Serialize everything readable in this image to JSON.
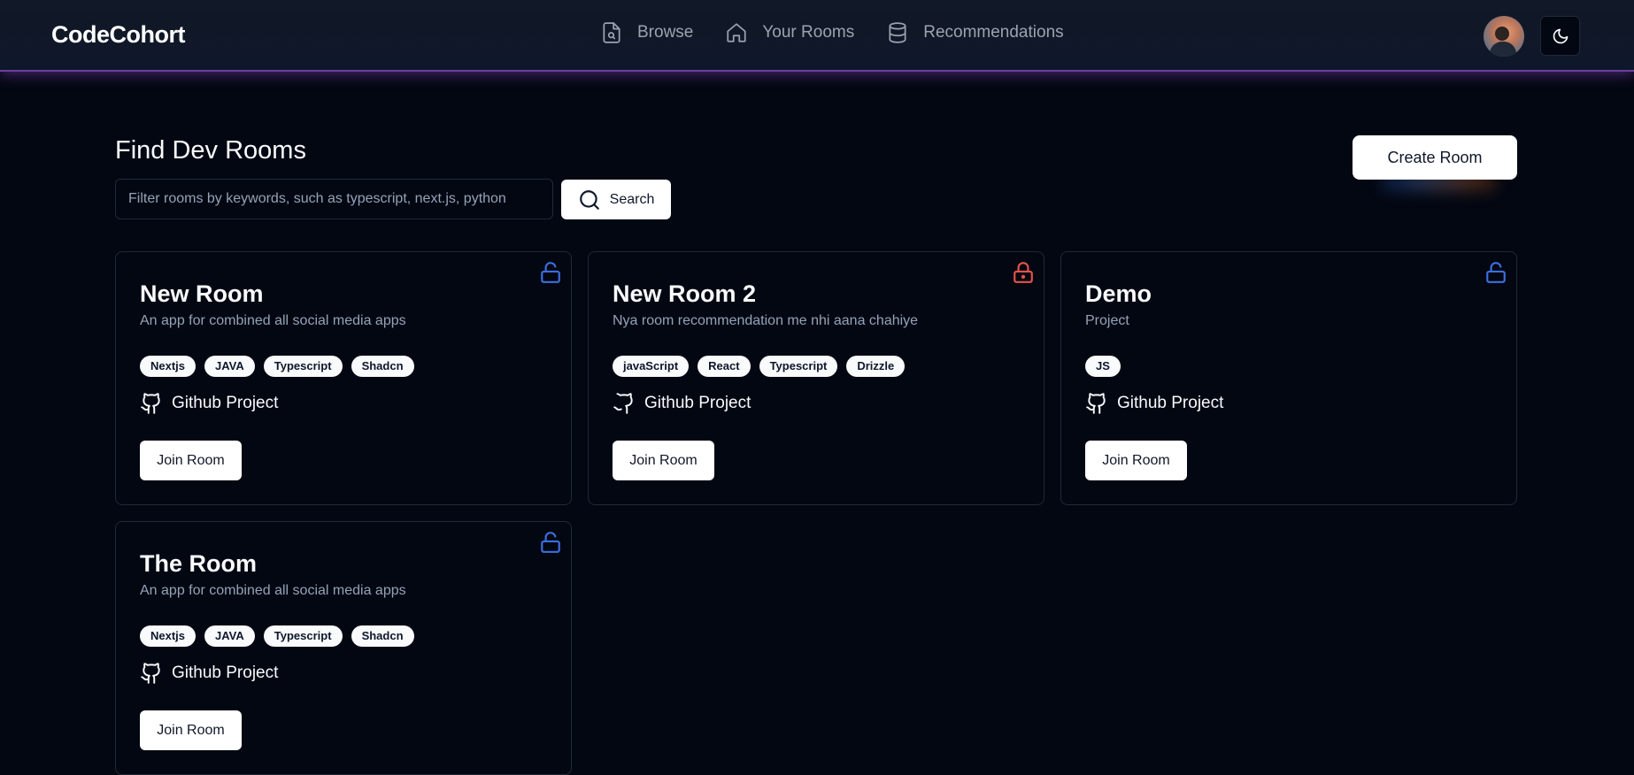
{
  "app": {
    "logo": "CodeCohort"
  },
  "nav": {
    "items": [
      {
        "label": "Browse",
        "icon": "file-search-icon"
      },
      {
        "label": "Your Rooms",
        "icon": "home-icon"
      },
      {
        "label": "Recommendations",
        "icon": "database-icon"
      }
    ]
  },
  "header": {
    "avatar": "avatar",
    "theme_toggle_icon": "moon-icon"
  },
  "main": {
    "title": "Find Dev Rooms",
    "search": {
      "placeholder": "Filter rooms by keywords, such as typescript, next.js, python",
      "value": "",
      "button_label": "Search",
      "button_icon": "search-icon"
    },
    "create_button_label": "Create Room"
  },
  "colors": {
    "unlocked": "#3b6fe0",
    "locked": "#e5534b",
    "header_accent": "#6b3fa0"
  },
  "rooms": [
    {
      "title": "New Room",
      "description": "An app for combined all social media apps",
      "tags": [
        "Nextjs",
        "JAVA",
        "Typescript",
        "Shadcn"
      ],
      "github_label": "Github Project",
      "join_label": "Join Room",
      "locked": false
    },
    {
      "title": "New Room 2",
      "description": "Nya room recommendation me nhi aana chahiye",
      "tags": [
        "javaScript",
        "React",
        "Typescript",
        "Drizzle"
      ],
      "github_label": "Github Project",
      "join_label": "Join Room",
      "locked": true
    },
    {
      "title": "Demo",
      "description": "Project",
      "tags": [
        "JS"
      ],
      "github_label": "Github Project",
      "join_label": "Join Room",
      "locked": false
    },
    {
      "title": "The Room",
      "description": "An app for combined all social media apps",
      "tags": [
        "Nextjs",
        "JAVA",
        "Typescript",
        "Shadcn"
      ],
      "github_label": "Github Project",
      "join_label": "Join Room",
      "locked": false
    }
  ]
}
